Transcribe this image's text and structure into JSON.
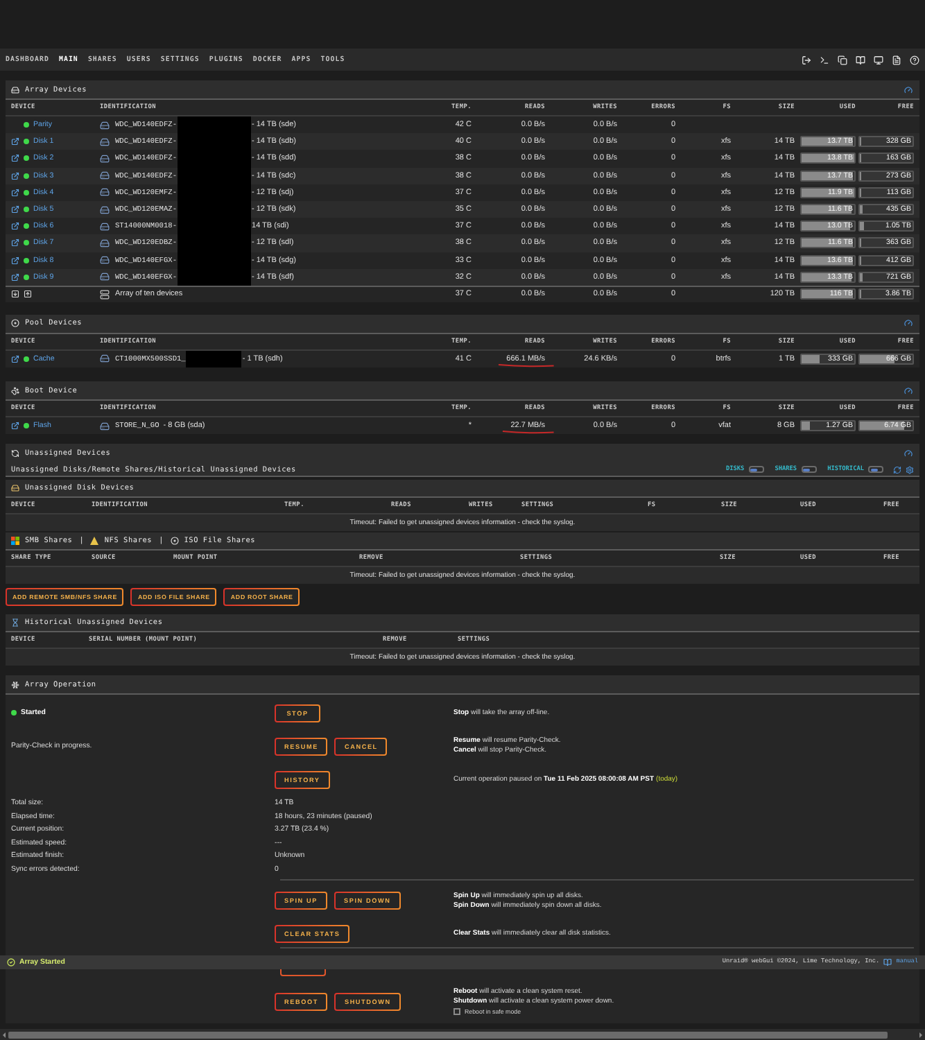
{
  "nav": {
    "items": [
      {
        "label": "DASHBOARD",
        "selected": false
      },
      {
        "label": "MAIN",
        "selected": true
      },
      {
        "label": "SHARES",
        "selected": false
      },
      {
        "label": "USERS",
        "selected": false
      },
      {
        "label": "SETTINGS",
        "selected": false
      },
      {
        "label": "PLUGINS",
        "selected": false
      },
      {
        "label": "DOCKER",
        "selected": false
      },
      {
        "label": "APPS",
        "selected": false
      },
      {
        "label": "TOOLS",
        "selected": false
      }
    ]
  },
  "array_devices": {
    "title": "Array Devices",
    "columns": [
      "DEVICE",
      "IDENTIFICATION",
      "TEMP.",
      "READS",
      "WRITES",
      "ERRORS",
      "FS",
      "SIZE",
      "USED",
      "FREE"
    ],
    "rows": [
      {
        "kind": "parity",
        "name": "Parity",
        "online": true,
        "identification": [
          "WDC_WD140EDFZ-",
          "- 14 TB (sde)"
        ],
        "redacted": true,
        "temp": "42 C",
        "reads": "0.0 B/s",
        "writes": "0.0 B/s",
        "errors": "0",
        "annotated": false
      },
      {
        "kind": "disk",
        "name": "Disk 1",
        "online": true,
        "identification": [
          "WDC_WD140EDFZ-",
          "- 14 TB (sdb)"
        ],
        "redacted": true,
        "temp": "40 C",
        "reads": "0.0 B/s",
        "writes": "0.0 B/s",
        "errors": "0",
        "annotated": false,
        "fs": "xfs",
        "size": "14 TB",
        "used": {
          "text": "13.7 TB",
          "level": 0.98
        },
        "free": {
          "text": "328 GB",
          "level": 0.02
        }
      },
      {
        "kind": "disk",
        "name": "Disk 2",
        "online": true,
        "identification": [
          "WDC_WD140EDFZ-",
          "- 14 TB (sdd)"
        ],
        "redacted": true,
        "temp": "38 C",
        "reads": "0.0 B/s",
        "writes": "0.0 B/s",
        "errors": "0",
        "annotated": false,
        "fs": "xfs",
        "size": "14 TB",
        "used": {
          "text": "13.8 TB",
          "level": 0.99
        },
        "free": {
          "text": "163 GB",
          "level": 0.01
        }
      },
      {
        "kind": "disk",
        "name": "Disk 3",
        "online": true,
        "identification": [
          "WDC_WD140EDFZ-",
          "- 14 TB (sdc)"
        ],
        "redacted": true,
        "temp": "38 C",
        "reads": "0.0 B/s",
        "writes": "0.0 B/s",
        "errors": "0",
        "annotated": false,
        "fs": "xfs",
        "size": "14 TB",
        "used": {
          "text": "13.7 TB",
          "level": 0.98
        },
        "free": {
          "text": "273 GB",
          "level": 0.02
        }
      },
      {
        "kind": "disk",
        "name": "Disk 4",
        "online": true,
        "identification": [
          "WDC_WD120EMFZ-",
          "- 12 TB (sdj)"
        ],
        "redacted": true,
        "temp": "37 C",
        "reads": "0.0 B/s",
        "writes": "0.0 B/s",
        "errors": "0",
        "annotated": false,
        "fs": "xfs",
        "size": "12 TB",
        "used": {
          "text": "11.9 TB",
          "level": 0.99
        },
        "free": {
          "text": "113 GB",
          "level": 0.01
        }
      },
      {
        "kind": "disk",
        "name": "Disk 5",
        "online": true,
        "identification": [
          "WDC_WD120EMAZ-",
          "- 12 TB (sdk)"
        ],
        "redacted": true,
        "temp": "35 C",
        "reads": "0.0 B/s",
        "writes": "0.0 B/s",
        "errors": "0",
        "annotated": false,
        "fs": "xfs",
        "size": "12 TB",
        "used": {
          "text": "11.6 TB",
          "level": 0.96
        },
        "free": {
          "text": "435 GB",
          "level": 0.04
        }
      },
      {
        "kind": "disk",
        "name": "Disk 6",
        "online": true,
        "identification": [
          "ST14000NM0018-",
          "14 TB (sdi)"
        ],
        "redacted": true,
        "temp": "37 C",
        "reads": "0.0 B/s",
        "writes": "0.0 B/s",
        "errors": "0",
        "annotated": false,
        "fs": "xfs",
        "size": "14 TB",
        "used": {
          "text": "13.0 TB",
          "level": 0.93
        },
        "free": {
          "text": "1.05 TB",
          "level": 0.07
        }
      },
      {
        "kind": "disk",
        "name": "Disk 7",
        "online": true,
        "identification": [
          "WDC_WD120EDBZ-",
          "- 12 TB (sdl)"
        ],
        "redacted": true,
        "temp": "38 C",
        "reads": "0.0 B/s",
        "writes": "0.0 B/s",
        "errors": "0",
        "annotated": false,
        "fs": "xfs",
        "size": "12 TB",
        "used": {
          "text": "11.6 TB",
          "level": 0.97
        },
        "free": {
          "text": "363 GB",
          "level": 0.03
        }
      },
      {
        "kind": "disk",
        "name": "Disk 8",
        "online": true,
        "identification": [
          "WDC_WD140EFGX-",
          "- 14 TB (sdg)"
        ],
        "redacted": true,
        "temp": "33 C",
        "reads": "0.0 B/s",
        "writes": "0.0 B/s",
        "errors": "0",
        "annotated": false,
        "fs": "xfs",
        "size": "14 TB",
        "used": {
          "text": "13.6 TB",
          "level": 0.97
        },
        "free": {
          "text": "412 GB",
          "level": 0.03
        }
      },
      {
        "kind": "disk",
        "name": "Disk 9",
        "online": true,
        "identification": [
          "WDC_WD140EFGX-",
          "- 14 TB (sdf)"
        ],
        "redacted": true,
        "temp": "32 C",
        "reads": "0.0 B/s",
        "writes": "0.0 B/s",
        "errors": "0",
        "annotated": false,
        "fs": "xfs",
        "size": "14 TB",
        "used": {
          "text": "13.3 TB",
          "level": 0.95
        },
        "free": {
          "text": "721 GB",
          "level": 0.05
        }
      }
    ],
    "total": {
      "label": "Array of ten devices",
      "temp": "37 C",
      "reads": "0.0 B/s",
      "writes": "0.0 B/s",
      "errors": "0",
      "size": "120 TB",
      "used": {
        "text": "116 TB",
        "level": 0.97
      },
      "free": {
        "text": "3.86 TB",
        "level": 0.03
      }
    }
  },
  "pool_devices": {
    "title": "Pool Devices",
    "columns": [
      "DEVICE",
      "IDENTIFICATION",
      "TEMP.",
      "READS",
      "WRITES",
      "ERRORS",
      "FS",
      "SIZE",
      "USED",
      "FREE"
    ],
    "rows": [
      {
        "kind": "disk",
        "name": "Cache",
        "online": true,
        "identification": [
          "CT1000MX500SSD1_",
          "- 1 TB (sdh)"
        ],
        "redacted": true,
        "temp": "41 C",
        "reads": "666.1 MB/s",
        "writes": "24.6 KB/s",
        "errors": "0",
        "annotated": true,
        "fs": "btrfs",
        "size": "1 TB",
        "used": {
          "text": "333 GB",
          "level": 0.33
        },
        "free": {
          "text": "666 GB",
          "level": 0.67
        }
      }
    ]
  },
  "boot_device": {
    "title": "Boot Device",
    "columns": [
      "DEVICE",
      "IDENTIFICATION",
      "TEMP.",
      "READS",
      "WRITES",
      "ERRORS",
      "FS",
      "SIZE",
      "USED",
      "FREE"
    ],
    "rows": [
      {
        "kind": "disk",
        "name": "Flash",
        "online": true,
        "identification": [
          "STORE_N_GO",
          "- 8 GB (sda)"
        ],
        "redacted": false,
        "temp": "*",
        "reads": "22.7 MB/s",
        "writes": "0.0 B/s",
        "errors": "0",
        "annotated": true,
        "fs": "vfat",
        "size": "8 GB",
        "used": {
          "text": "1.27 GB",
          "level": 0.16
        },
        "free": {
          "text": "6.74 GB",
          "level": 0.84
        }
      }
    ]
  },
  "unassigned": {
    "title": "Unassigned Devices",
    "subtitle": "Unassigned Disks/Remote Shares/Historical Unassigned Devices",
    "switches": [
      {
        "label": "DISKS",
        "on": true
      },
      {
        "label": "SHARES",
        "on": true
      },
      {
        "label": "HISTORICAL",
        "on": true
      }
    ],
    "disks": {
      "title": "Unassigned Disk Devices",
      "columns": [
        "DEVICE",
        "IDENTIFICATION",
        "TEMP.",
        "READS",
        "WRITES",
        "SETTINGS",
        "FS",
        "SIZE",
        "USED",
        "FREE"
      ],
      "message": "Timeout: Failed to get unassigned devices information - check the syslog."
    },
    "shares": {
      "titles": [
        "SMB Shares",
        "NFS Shares",
        "ISO File Shares"
      ],
      "separator": "|",
      "columns": [
        "SHARE TYPE",
        "SOURCE",
        "MOUNT POINT",
        "REMOVE",
        "SETTINGS",
        "SIZE",
        "USED",
        "FREE"
      ],
      "message": "Timeout: Failed to get unassigned devices information - check the syslog.",
      "buttons": [
        "ADD REMOTE SMB/NFS SHARE",
        "ADD ISO FILE SHARE",
        "ADD ROOT SHARE"
      ]
    },
    "historical": {
      "title": "Historical Unassigned Devices",
      "columns": [
        "DEVICE",
        "SERIAL NUMBER (MOUNT POINT)",
        "REMOVE",
        "SETTINGS"
      ],
      "message": "Timeout: Failed to get unassigned devices information - check the syslog."
    }
  },
  "array_operation": {
    "title": "Array Operation",
    "status": {
      "label": "Started",
      "running": true
    },
    "actions": [
      {
        "kind": "status",
        "buttons": [
          "STOP"
        ],
        "help": [
          "**Stop** will take the array off-line."
        ]
      },
      {
        "kind": "label",
        "label": "Parity-Check in progress.",
        "buttons": [
          "RESUME",
          "CANCEL"
        ],
        "help": [
          "**Resume** will resume Parity-Check.",
          "**Cancel** will stop Parity-Check."
        ]
      },
      {
        "kind": "plain",
        "buttons": [
          "HISTORY"
        ],
        "help": [
          "Current operation paused on **Tue 11 Feb 2025 08:00:08 AM PST**"
        ],
        "note": "(today)"
      }
    ],
    "stats": [
      {
        "label": "Total size:",
        "value": "14 TB"
      },
      {
        "label": "Elapsed time:",
        "value": "18 hours, 23 minutes (paused)"
      },
      {
        "label": "Current position:",
        "value": "3.27 TB (23.4 %)"
      },
      {
        "label": "Estimated speed:",
        "value": "---"
      },
      {
        "label": "Estimated finish:",
        "value": "Unknown"
      },
      {
        "label": "Sync errors detected:",
        "value": "0"
      }
    ],
    "maintenance": [
      {
        "buttons": [
          "SPIN UP",
          "SPIN DOWN"
        ],
        "help": [
          "**Spin Up** will immediately spin up all disks.",
          "**Spin Down** will immediately spin down all disks."
        ]
      },
      {
        "buttons": [
          "CLEAR STATS"
        ],
        "help": [
          "**Clear Stats** will immediately clear all disk statistics."
        ]
      }
    ],
    "power": {
      "buttons": [
        "REBOOT",
        "SHUTDOWN"
      ],
      "help": [
        "**Reboot** will activate a clean system reset.",
        "**Shutdown** will activate a clean system power down."
      ],
      "safe_mode": {
        "label": "Reboot in safe mode",
        "checked": false
      }
    }
  },
  "footer": {
    "status": "Array Started",
    "copyright": "Unraid® webGui ©2024, Lime Technology, Inc.",
    "link": "manual"
  }
}
